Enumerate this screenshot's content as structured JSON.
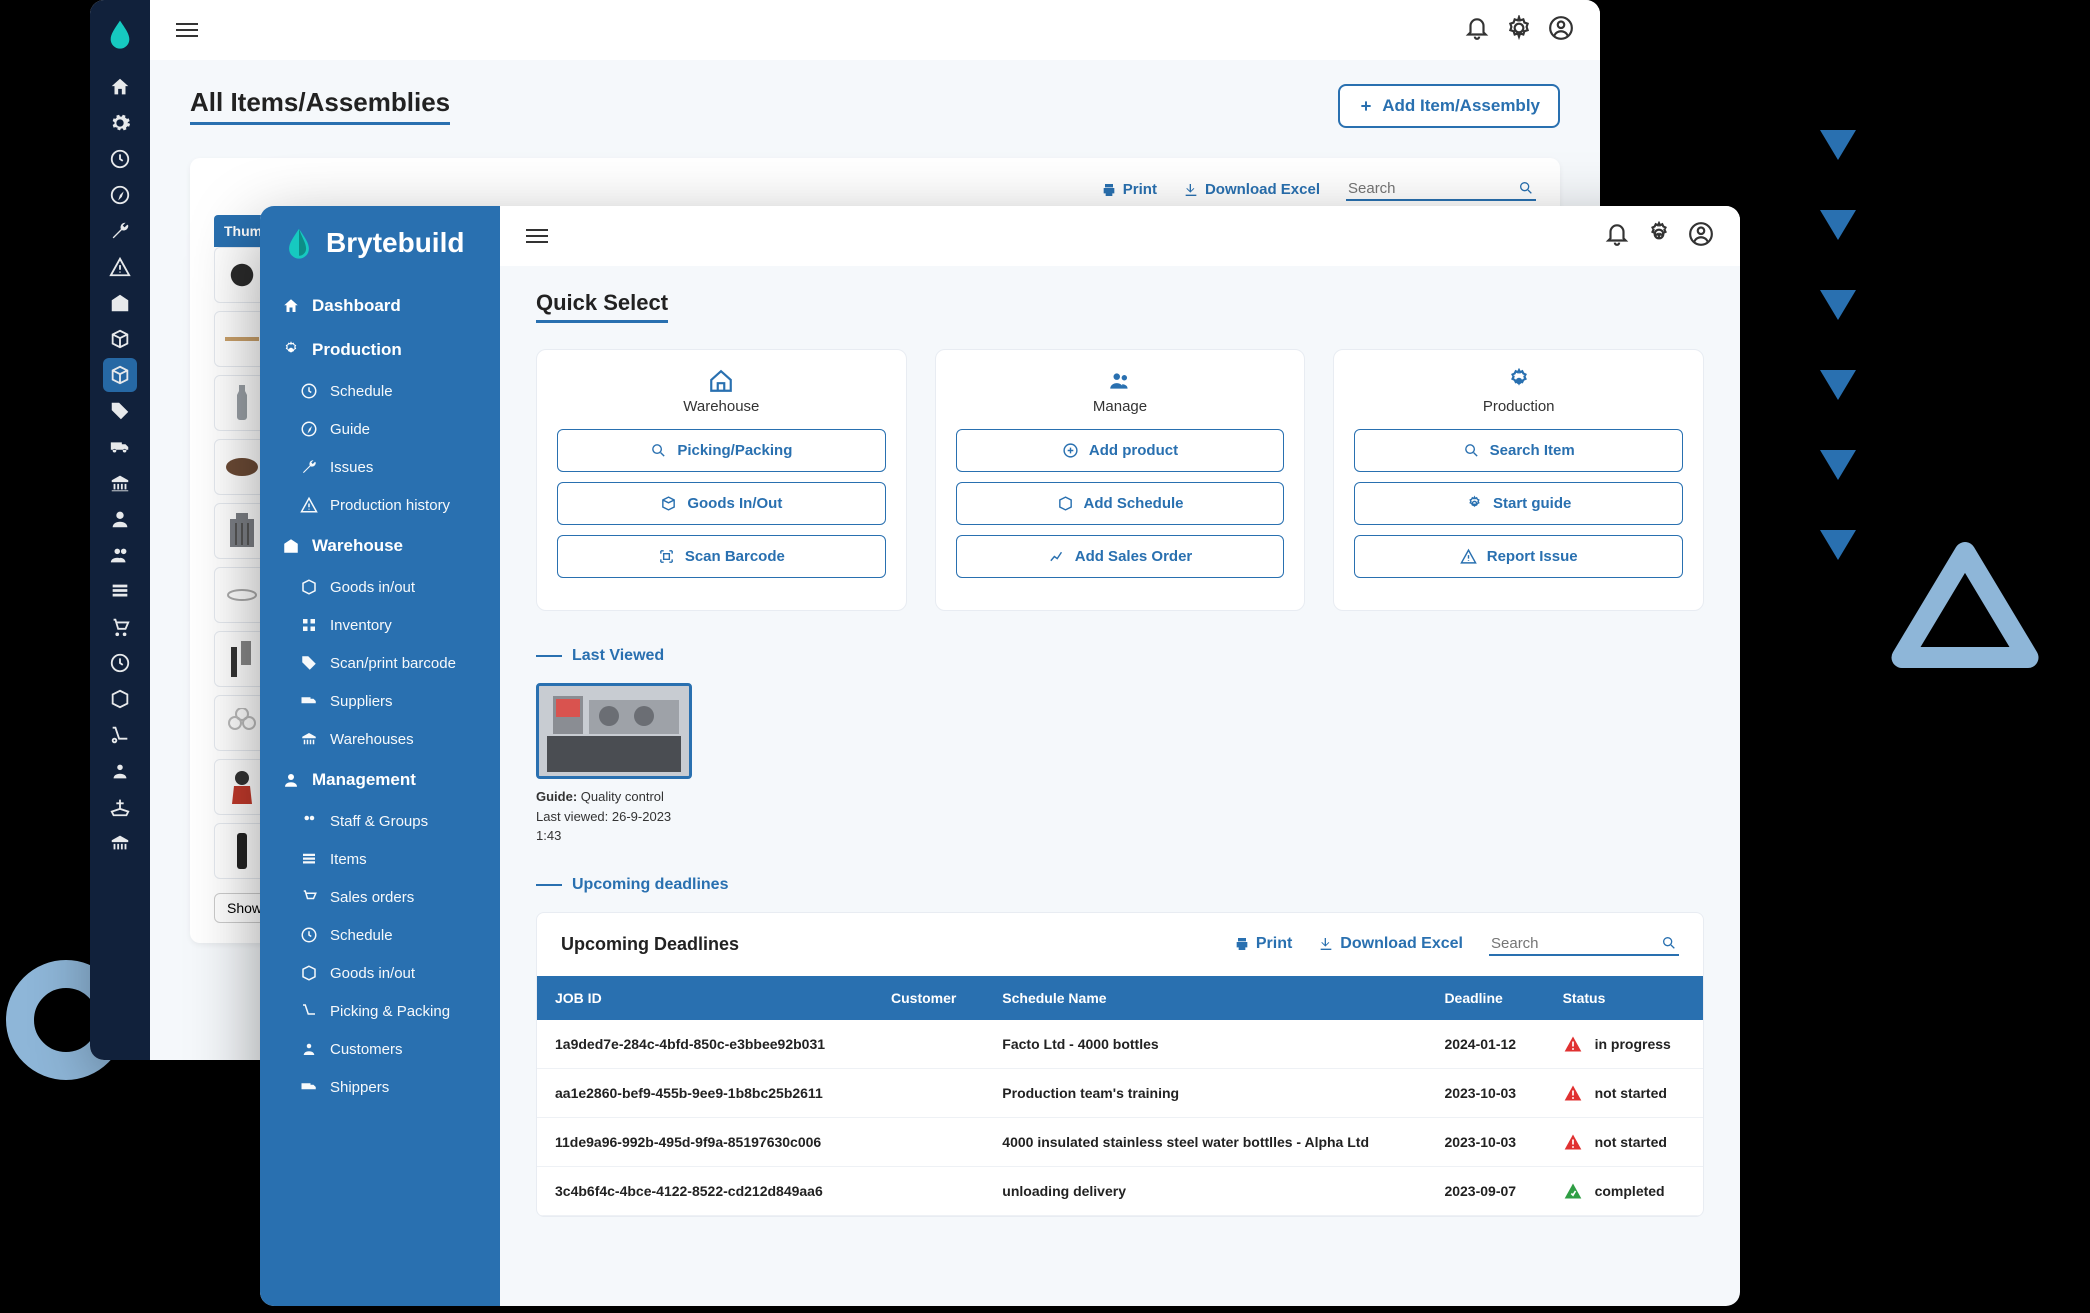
{
  "back_window": {
    "title": "All Items/Assemblies",
    "add_button": "Add Item/Assembly",
    "print": "Print",
    "download": "Download Excel",
    "search_placeholder": "Search",
    "thumb_header": "Thumbn",
    "show_button": "Show"
  },
  "brand": "Brytebuild",
  "sidebar": {
    "dashboard": "Dashboard",
    "production": "Production",
    "schedule": "Schedule",
    "guide": "Guide",
    "issues": "Issues",
    "production_history": "Production history",
    "warehouse": "Warehouse",
    "goods_in_out": "Goods in/out",
    "inventory": "Inventory",
    "scan_print": "Scan/print barcode",
    "suppliers": "Suppliers",
    "warehouses": "Warehouses",
    "management": "Management",
    "staff_groups": "Staff & Groups",
    "items": "Items",
    "sales_orders": "Sales orders",
    "schedule2": "Schedule",
    "goods_in_out2": "Goods in/out",
    "picking_packing": "Picking & Packing",
    "customers": "Customers",
    "shippers": "Shippers"
  },
  "quick_select_title": "Quick Select",
  "quick": {
    "warehouse_label": "Warehouse",
    "manage_label": "Manage",
    "production_label": "Production",
    "picking_packing": "Picking/Packing",
    "goods_in_out": "Goods In/Out",
    "scan_barcode": "Scan Barcode",
    "add_product": "Add product",
    "add_schedule": "Add Schedule",
    "add_sales_order": "Add Sales Order",
    "search_item": "Search Item",
    "start_guide": "Start guide",
    "report_issue": "Report Issue"
  },
  "last_viewed_label": "Last Viewed",
  "last_viewed": {
    "guide_prefix": "Guide:",
    "guide_name": "Quality control",
    "last_viewed_prefix": "Last viewed:",
    "last_viewed_value": "26-9-2023 1:43"
  },
  "upcoming_label": "Upcoming deadlines",
  "deadlines": {
    "title": "Upcoming Deadlines",
    "print": "Print",
    "download": "Download Excel",
    "search_placeholder": "Search",
    "columns": {
      "job_id": "JOB ID",
      "customer": "Customer",
      "schedule": "Schedule Name",
      "deadline": "Deadline",
      "status": "Status"
    },
    "rows": [
      {
        "job_id": "1a9ded7e-284c-4bfd-850c-e3bbee92b031",
        "customer": "",
        "schedule": "Facto Ltd - 4000 bottles",
        "deadline": "2024-01-12",
        "status": "in progress",
        "status_icon": "warn"
      },
      {
        "job_id": "aa1e2860-bef9-455b-9ee9-1b8bc25b2611",
        "customer": "",
        "schedule": "Production team's training",
        "deadline": "2023-10-03",
        "status": "not started",
        "status_icon": "warn"
      },
      {
        "job_id": "11de9a96-992b-495d-9f9a-85197630c006",
        "customer": "",
        "schedule": "4000 insulated stainless steel water bottlles - Alpha Ltd",
        "deadline": "2023-10-03",
        "status": "not started",
        "status_icon": "warn"
      },
      {
        "job_id": "3c4b6f4c-4bce-4122-8522-cd212d849aa6",
        "customer": "",
        "schedule": "unloading delivery",
        "deadline": "2023-09-07",
        "status": "completed",
        "status_icon": "ok"
      }
    ]
  }
}
